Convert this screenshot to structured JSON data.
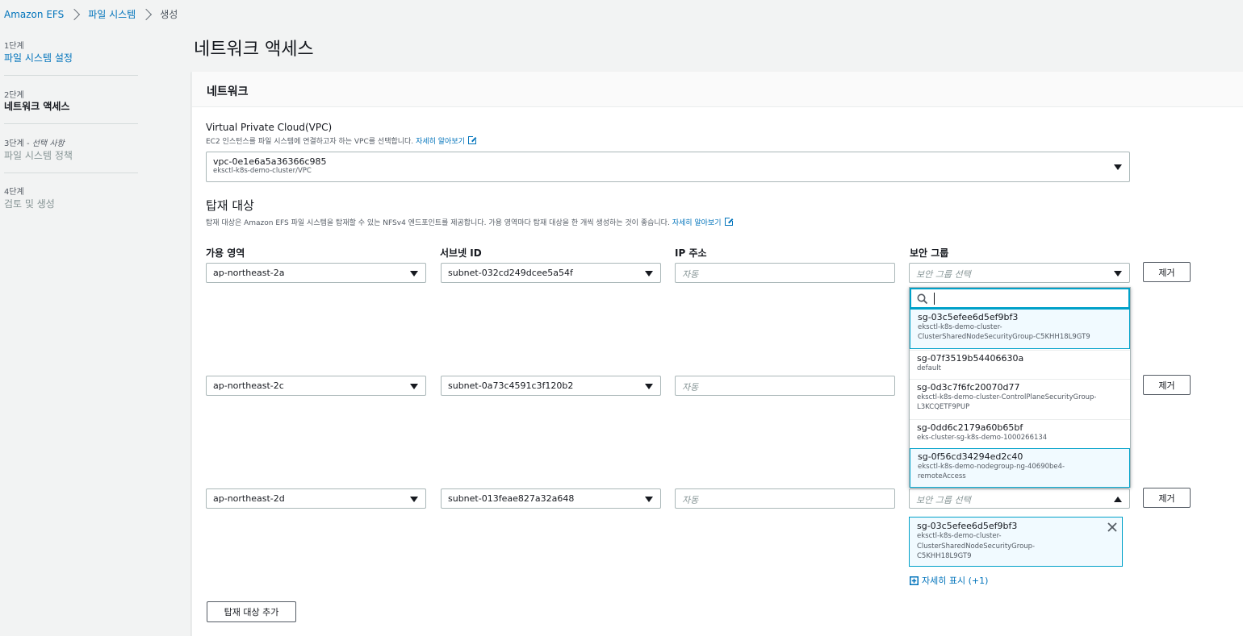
{
  "breadcrumb": {
    "items": [
      "Amazon EFS",
      "파일 시스템"
    ],
    "current": "생성"
  },
  "steps": [
    {
      "num": "1단계",
      "title": "파일 시스템 설정"
    },
    {
      "num": "2단계",
      "title": "네트워크 액세스"
    },
    {
      "num": "3단계 - ",
      "num_optional": "선택 사항",
      "title": "파일 시스템 정책"
    },
    {
      "num": "4단계",
      "title": "검토 및 생성"
    }
  ],
  "page_title": "네트워크 액세스",
  "panel": {
    "title": "네트워크"
  },
  "vpc": {
    "label": "Virtual Private Cloud(VPC)",
    "description": "EC2 인스턴스를 파일 시스템에 연결하고자 하는 VPC를 선택합니다.",
    "learn_more": "자세히 알아보기",
    "value": "vpc-0e1e6a5a36366c985",
    "sub": "eksctl-k8s-demo-cluster/VPC"
  },
  "mount": {
    "heading": "탑재 대상",
    "description": "탑재 대상은 Amazon EFS 파일 시스템을 탑재할 수 있는 NFSv4 엔드포인트를 제공합니다. 가용 영역마다 탑재 대상을 한 개씩 생성하는 것이 좋습니다.",
    "learn_more": "자세히 알아보기",
    "columns": {
      "az": "가용 영역",
      "subnet": "서브넷 ID",
      "ip": "IP 주소",
      "sg": "보안 그룹"
    },
    "rows": [
      {
        "az": "ap-northeast-2a",
        "subnet": "subnet-032cd249dcee5a54f",
        "ip_placeholder": "자동",
        "sg_placeholder": "보안 그룹 선택",
        "remove": "제거"
      },
      {
        "az": "ap-northeast-2c",
        "subnet": "subnet-0a73c4591c3f120b2",
        "ip_placeholder": "자동",
        "remove": "제거"
      },
      {
        "az": "ap-northeast-2d",
        "subnet": "subnet-013feae827a32a648",
        "ip_placeholder": "자동",
        "sg_placeholder": "보안 그룹 선택",
        "remove": "제거"
      }
    ],
    "add_button": "탑재 대상 추가"
  },
  "sg_dropdown": {
    "search_value": "",
    "options": [
      {
        "id": "sg-03c5efee6d5ef9bf3",
        "name": "eksctl-k8s-demo-cluster-ClusterSharedNodeSecurityGroup-C5KHH18L9GT9",
        "line1": "eksctl-k8s-demo-cluster-",
        "line2": "ClusterSharedNodeSecurityGroup-C5KHH18L9GT9",
        "selected": true
      },
      {
        "id": "sg-07f3519b54406630a",
        "name": "default",
        "line1": "default",
        "selected": false
      },
      {
        "id": "sg-0d3c7f6fc20070d77",
        "name": "eksctl-k8s-demo-cluster-ControlPlaneSecurityGroup-L3KCQETF9PUP",
        "line1": "eksctl-k8s-demo-cluster-ControlPlaneSecurityGroup-",
        "line2": "L3KCQETF9PUP",
        "selected": false
      },
      {
        "id": "sg-0dd6c2179a60b65bf",
        "name": "eks-cluster-sg-k8s-demo-1000266134",
        "line1": "eks-cluster-sg-k8s-demo-1000266134",
        "selected": false
      },
      {
        "id": "sg-0f56cd34294ed2c40",
        "name": "eksctl-k8s-demo-nodegroup-ng-40690be4-remoteAccess",
        "line1": "eksctl-k8s-demo-nodegroup-ng-40690be4-",
        "line2": "remoteAccess",
        "selected": true
      }
    ]
  },
  "selected_token": {
    "id": "sg-03c5efee6d5ef9bf3",
    "line1": "eksctl-k8s-demo-cluster-",
    "line2": "ClusterSharedNodeSecurityGroup-",
    "line3": "C5KHH18L9GT9"
  },
  "show_more": "자세히 표시 (+1)",
  "colors": {
    "link": "#0073bb",
    "focus": "#00a1c9",
    "selected_bg": "#f1faff"
  }
}
